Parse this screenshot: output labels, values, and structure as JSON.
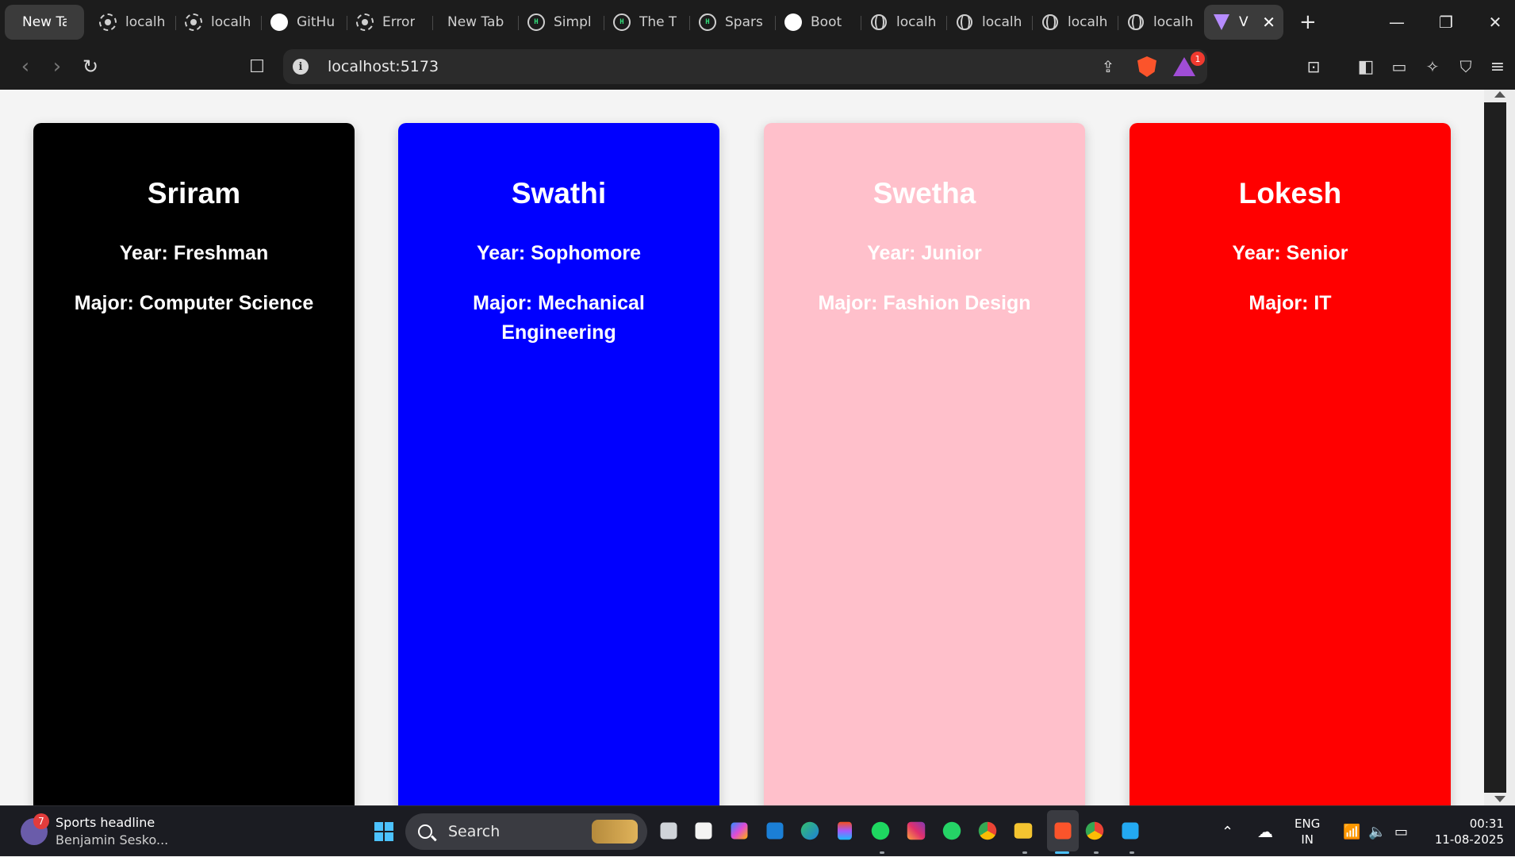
{
  "browser": {
    "tabs": [
      {
        "label": "New Tab",
        "icon": "none"
      },
      {
        "label": "localh",
        "icon": "loading-icon"
      },
      {
        "label": "localh",
        "icon": "loading-icon"
      },
      {
        "label": "GitHu",
        "icon": "github-icon"
      },
      {
        "label": "Error",
        "icon": "loading-icon"
      },
      {
        "label": "New Tab",
        "icon": "none"
      },
      {
        "label": "Simpl",
        "icon": "hashnode-icon"
      },
      {
        "label": "The T",
        "icon": "hashnode-icon"
      },
      {
        "label": "Spars",
        "icon": "hashnode-icon"
      },
      {
        "label": "Boot",
        "icon": "github-icon"
      },
      {
        "label": "localh",
        "icon": "globe-icon"
      },
      {
        "label": "localh",
        "icon": "globe-icon"
      },
      {
        "label": "localh",
        "icon": "globe-icon"
      },
      {
        "label": "localh",
        "icon": "globe-icon"
      },
      {
        "label": "V",
        "icon": "vite-icon",
        "active": true
      }
    ],
    "address": "localhost:5173",
    "rewards_badge": "1"
  },
  "cards": [
    {
      "name": "Sriram",
      "year_label": "Year:",
      "year": "Freshman",
      "major_label": "Major:",
      "major": "Computer Science",
      "bg": "#000000",
      "fg": "#ffffff"
    },
    {
      "name": "Swathi",
      "year_label": "Year:",
      "year": "Sophomore",
      "major_label": "Major:",
      "major": "Mechanical Engineering",
      "bg": "#0000ff",
      "fg": "#ffffff"
    },
    {
      "name": "Swetha",
      "year_label": "Year:",
      "year": "Junior",
      "major_label": "Major:",
      "major": "Fashion Design",
      "bg": "#ffc0cb",
      "fg": "#ffffff"
    },
    {
      "name": "Lokesh",
      "year_label": "Year:",
      "year": "Senior",
      "major_label": "Major:",
      "major": "IT",
      "bg": "#ff0000",
      "fg": "#ffffff"
    }
  ],
  "taskbar": {
    "news_badge": "7",
    "news_title": "Sports headline",
    "news_sub": "Benjamin Sesko...",
    "search_label": "Search",
    "lang_top": "ENG",
    "lang_bottom": "IN",
    "time": "00:31",
    "date": "11-08-2025"
  }
}
